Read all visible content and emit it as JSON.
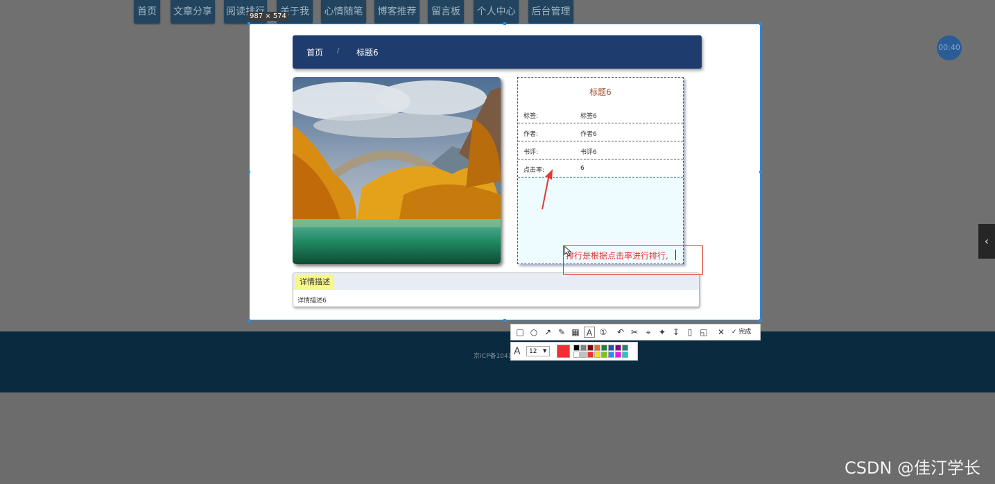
{
  "background": {
    "nav": [
      "首页",
      "文章分享",
      "阅读排行",
      "关于我",
      "心情随笔",
      "博客推荐",
      "留言板",
      "个人中心",
      "后台管理"
    ],
    "timer": "00:40",
    "footer_text": "京ICP备1041",
    "watermark": "CSDN @佳汀学长"
  },
  "capture": {
    "size_label": "987 × 574",
    "breadcrumb": {
      "home": "首页",
      "separator": "/",
      "current": "标题6"
    },
    "info": {
      "title": "标题6",
      "rows": [
        {
          "key": "标签:",
          "value": "标签6"
        },
        {
          "key": "作者:",
          "value": "作者6"
        },
        {
          "key": "书评:",
          "value": "书评6"
        },
        {
          "key": "点击率:",
          "value": "6"
        }
      ]
    },
    "description": {
      "tab": "详情描述",
      "body": "详情描述6"
    }
  },
  "annotation": {
    "text": "排行是根据点击率进行排行,",
    "color": "#e53935"
  },
  "toolbar": {
    "tools": [
      "rectangle-icon",
      "ellipse-icon",
      "arrow-icon",
      "pen-icon",
      "mosaic-icon",
      "text-icon",
      "number-icon",
      "undo-icon",
      "ocr-icon",
      "translate-icon",
      "pin-icon",
      "download-icon",
      "save-icon",
      "bookmark-icon",
      "close-icon",
      "check-icon"
    ],
    "done_label": "完成",
    "font_size": "12",
    "current_color": "#f03030",
    "palette_top": [
      "#000000",
      "#808080",
      "#800000",
      "#e07020",
      "#208040",
      "#2050c0",
      "#800080",
      "#208080"
    ],
    "palette_bottom": [
      "#ffffff",
      "#c0c0c0",
      "#f03030",
      "#f0e020",
      "#80c020",
      "#3090e0",
      "#e020e0",
      "#20c8c8"
    ]
  }
}
